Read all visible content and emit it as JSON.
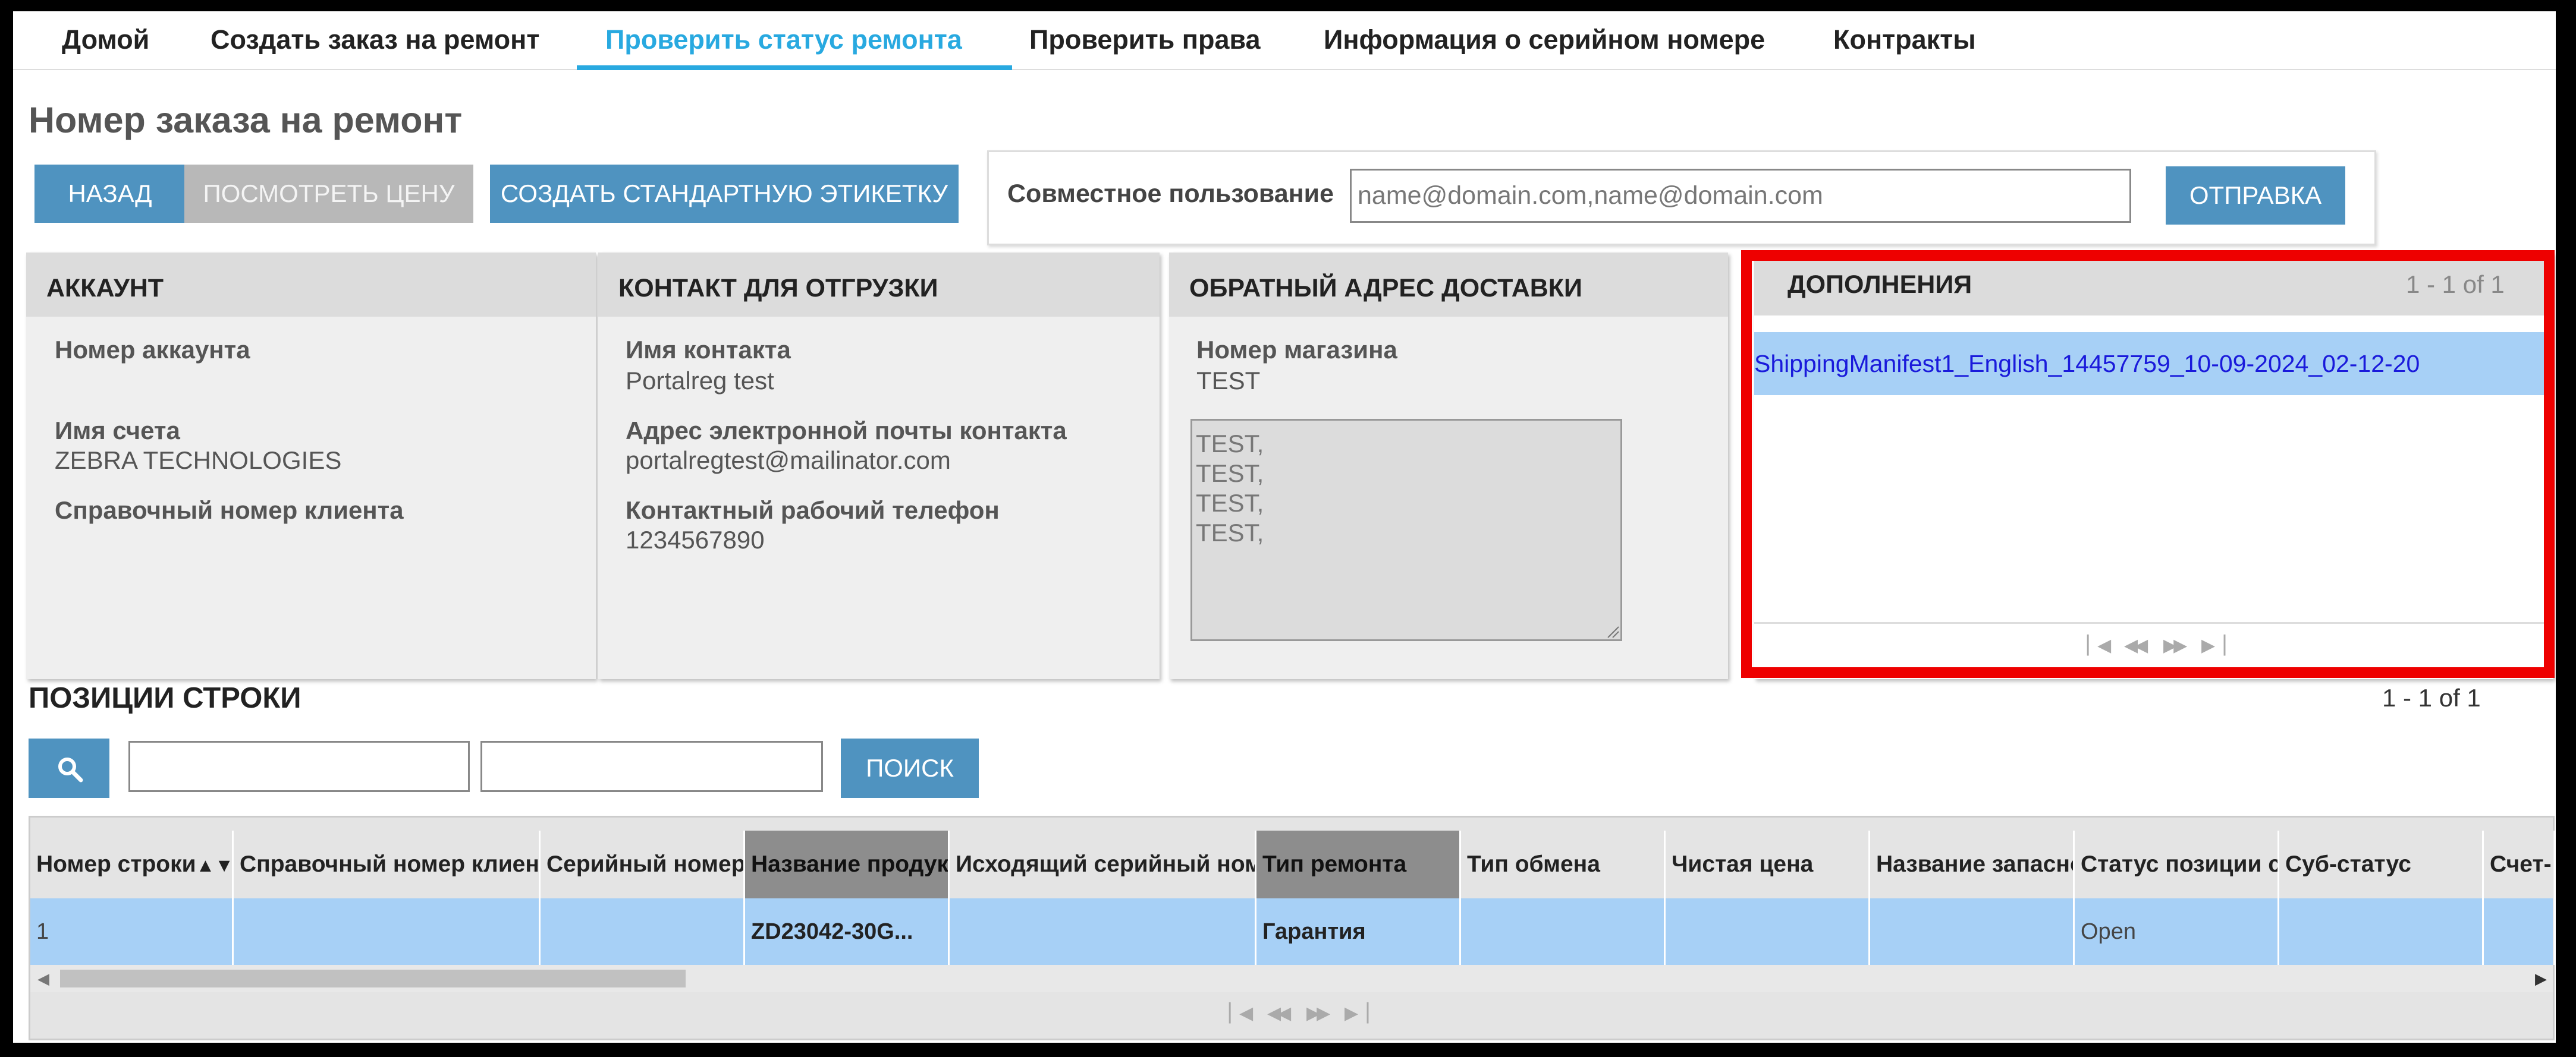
{
  "nav": {
    "tabs": [
      "Домой",
      "Создать заказ на ремонт",
      "Проверить статус ремонта",
      "Проверить права",
      "Информация о серийном номере",
      "Контракты"
    ],
    "active_tab": "Проверить статус ремонта"
  },
  "page_title": "Номер заказа на ремонт",
  "toolbar": {
    "back_label": "НАЗАД",
    "view_price_label": "ПОСМОТРЕТЬ ЦЕНУ",
    "create_label_label": "СОЗДАТЬ СТАНДАРТНУЮ ЭТИКЕТКУ"
  },
  "share": {
    "label": "Совместное пользование",
    "placeholder": "name@domain.com,name@domain.com",
    "submit_label": "ОТПРАВКА"
  },
  "account": {
    "title": "АККАУНТ",
    "account_number_label": "Номер аккаунта",
    "account_name_label": "Имя счета",
    "account_name_value": "ZEBRA TECHNOLOGIES",
    "customer_ref_label": "Справочный номер клиента"
  },
  "shipping_contact": {
    "title": "КОНТАКТ ДЛЯ ОТГРУЗКИ",
    "contact_name_label": "Имя контакта",
    "contact_name_value": "Portalreg test",
    "email_label": "Адрес электронной почты контакта",
    "email_value": "portalregtest@mailinator.com",
    "phone_label": "Контактный рабочий телефон",
    "phone_value": "1234567890"
  },
  "return_address": {
    "title": "ОБРАТНЫЙ АДРЕС ДОСТАВКИ",
    "store_label": "Номер магазина",
    "store_value": "TEST",
    "address_text": "TEST,\nTEST,\nTEST,\nTEST,"
  },
  "attachments": {
    "title": "ДОПОЛНЕНИЯ",
    "count": "1 - 1 of 1",
    "files": [
      "ShippingManifest1_English_14457759_10-09-2024_02-12-20"
    ]
  },
  "line_items": {
    "title": "ПОЗИЦИИ СТРОКИ",
    "count": "1 - 1 of 1",
    "search_label": "ПОИСК",
    "columns": [
      "Номер строки",
      "Справочный номер клиента",
      "Серийный номер",
      "Название продукта",
      "Исходящий серийный номер",
      "Тип ремонта",
      "Тип обмена",
      "Чистая цена",
      "Название запасной",
      "Статус позиции строки",
      "Суб-статус",
      "Счет-"
    ],
    "rows": [
      {
        "line": "1",
        "customer_ref": "",
        "serial": "",
        "product": "ZD23042-30G...",
        "out_serial": "",
        "repair_type": "Гарантия",
        "exchange_type": "",
        "net_price": "",
        "spare_name": "",
        "status": "Open",
        "sub_status": "",
        "invoice": ""
      }
    ]
  },
  "colors": {
    "accent": "#28a9e0",
    "button": "#4f93c0",
    "selected_row": "#a7d0f6",
    "highlight": "#ee0000",
    "link": "#1a1adb"
  }
}
